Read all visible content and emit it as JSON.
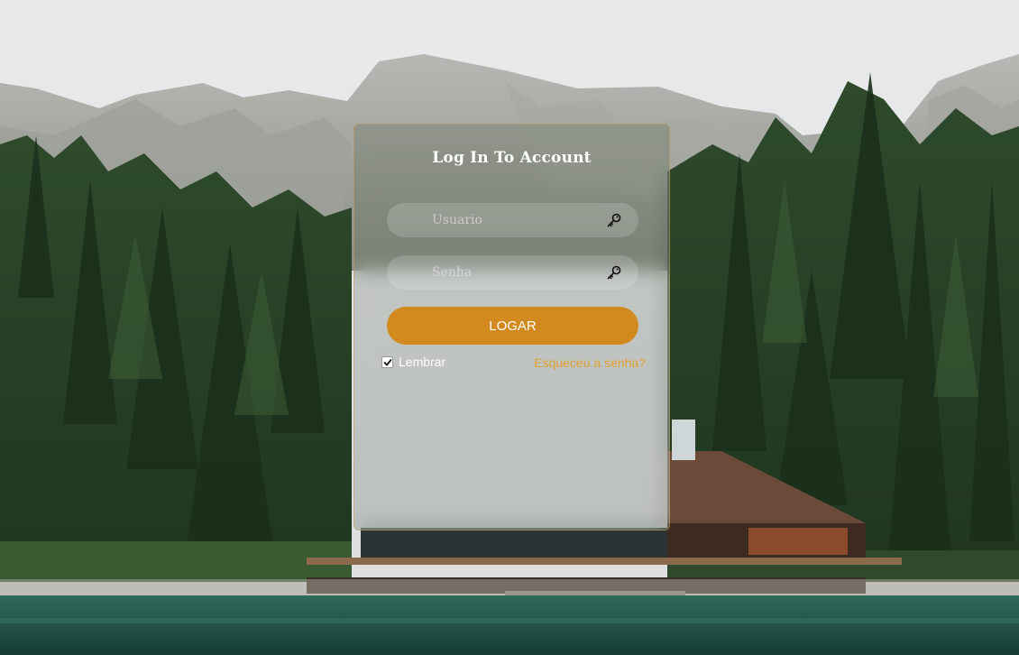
{
  "login": {
    "title": "Log In To Account",
    "username_placeholder": "Usuario",
    "password_placeholder": "Senha",
    "submit_label": "LOGAR",
    "remember_label": "Lembrar",
    "remember_checked": true,
    "forgot_label": "Esqueceu a senha?"
  },
  "colors": {
    "accent": "#d2891e",
    "link": "#e0a032",
    "title": "#ffffff"
  },
  "icons": {
    "username_field_icon": "key-icon",
    "password_field_icon": "key-icon"
  }
}
